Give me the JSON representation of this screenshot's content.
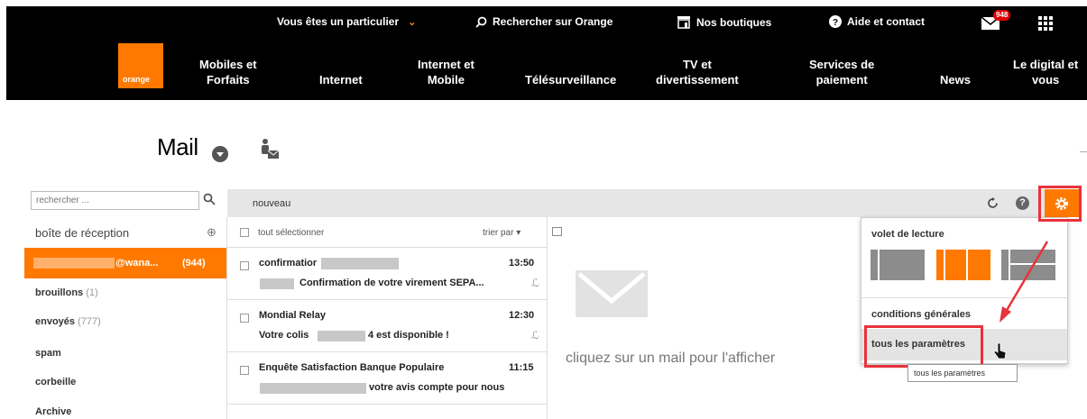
{
  "header": {
    "utility": {
      "particulier": "Vous êtes un particulier",
      "search": "Rechercher sur Orange",
      "shops": "Nos boutiques",
      "help": "Aide et contact",
      "mail_badge": "948"
    },
    "logo_text": "orange",
    "nav": [
      "Mobiles et\nForfaits",
      "Internet",
      "Internet et\nMobile",
      "Télésurveillance",
      "TV et\ndivertissement",
      "Services de\npaiement",
      "News",
      "Le digital et\nvous"
    ],
    "brand_color": "#ff7900"
  },
  "mail_title": "Mail",
  "search": {
    "placeholder": "rechercher ..."
  },
  "toolbar": {
    "new_label": "nouveau"
  },
  "folders": {
    "inbox": "boîte de réception",
    "account": {
      "email": "@wana...",
      "count": "(944)"
    },
    "items": [
      {
        "name": "brouillons",
        "count": "(1)"
      },
      {
        "name": "envoyés",
        "count": "(777)"
      },
      {
        "name": "spam",
        "count": ""
      },
      {
        "name": "corbeille",
        "count": ""
      },
      {
        "name": "Archive",
        "count": ""
      }
    ]
  },
  "list": {
    "select_all": "tout sélectionner",
    "sort_by": "trier par",
    "messages": [
      {
        "from": "confirmatior",
        "time": "13:50",
        "subject": "Confirmation de votre virement SEPA..."
      },
      {
        "from": "Mondial Relay",
        "time": "12:30",
        "subject_pre": "Votre colis",
        "subject_post": "4 est disponible !"
      },
      {
        "from": "Enquête Satisfaction Banque Populaire",
        "time": "11:15",
        "subject": "votre avis compte pour nous"
      }
    ]
  },
  "reading_pane": {
    "empty_text": "cliquez sur un mail pour l'afficher"
  },
  "settings_menu": {
    "reading_pane_label": "volet de lecture",
    "terms": "conditions générales",
    "all_settings": "tous les paramètres",
    "tooltip": "tous les paramètres"
  }
}
